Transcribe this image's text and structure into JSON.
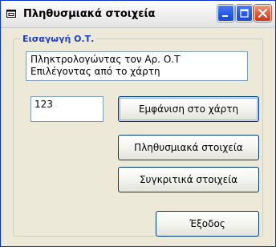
{
  "window": {
    "title": "Πληθυσμιακά στοιχεία"
  },
  "titlebar_buttons": {
    "minimize": "minimize-icon",
    "maximize": "maximize-icon",
    "close": "close-icon"
  },
  "group": {
    "label": "Εισαγωγή Ο.Τ."
  },
  "options": [
    "Πληκτρολογώντας τον Αρ. Ο.Τ",
    "Επιλέγοντας από το χάρτη"
  ],
  "ot_input": {
    "value": "123"
  },
  "buttons": {
    "show_on_map": "Εμφάνιση στο χάρτη",
    "population": "Πληθυσμιακά στοιχεία",
    "comparative": "Συγκριτικά στοιχεία",
    "exit": "Έξοδος"
  },
  "colors": {
    "group_label": "#1f3ec8",
    "face": "#ece9d8",
    "window_border": "#0831d9"
  }
}
